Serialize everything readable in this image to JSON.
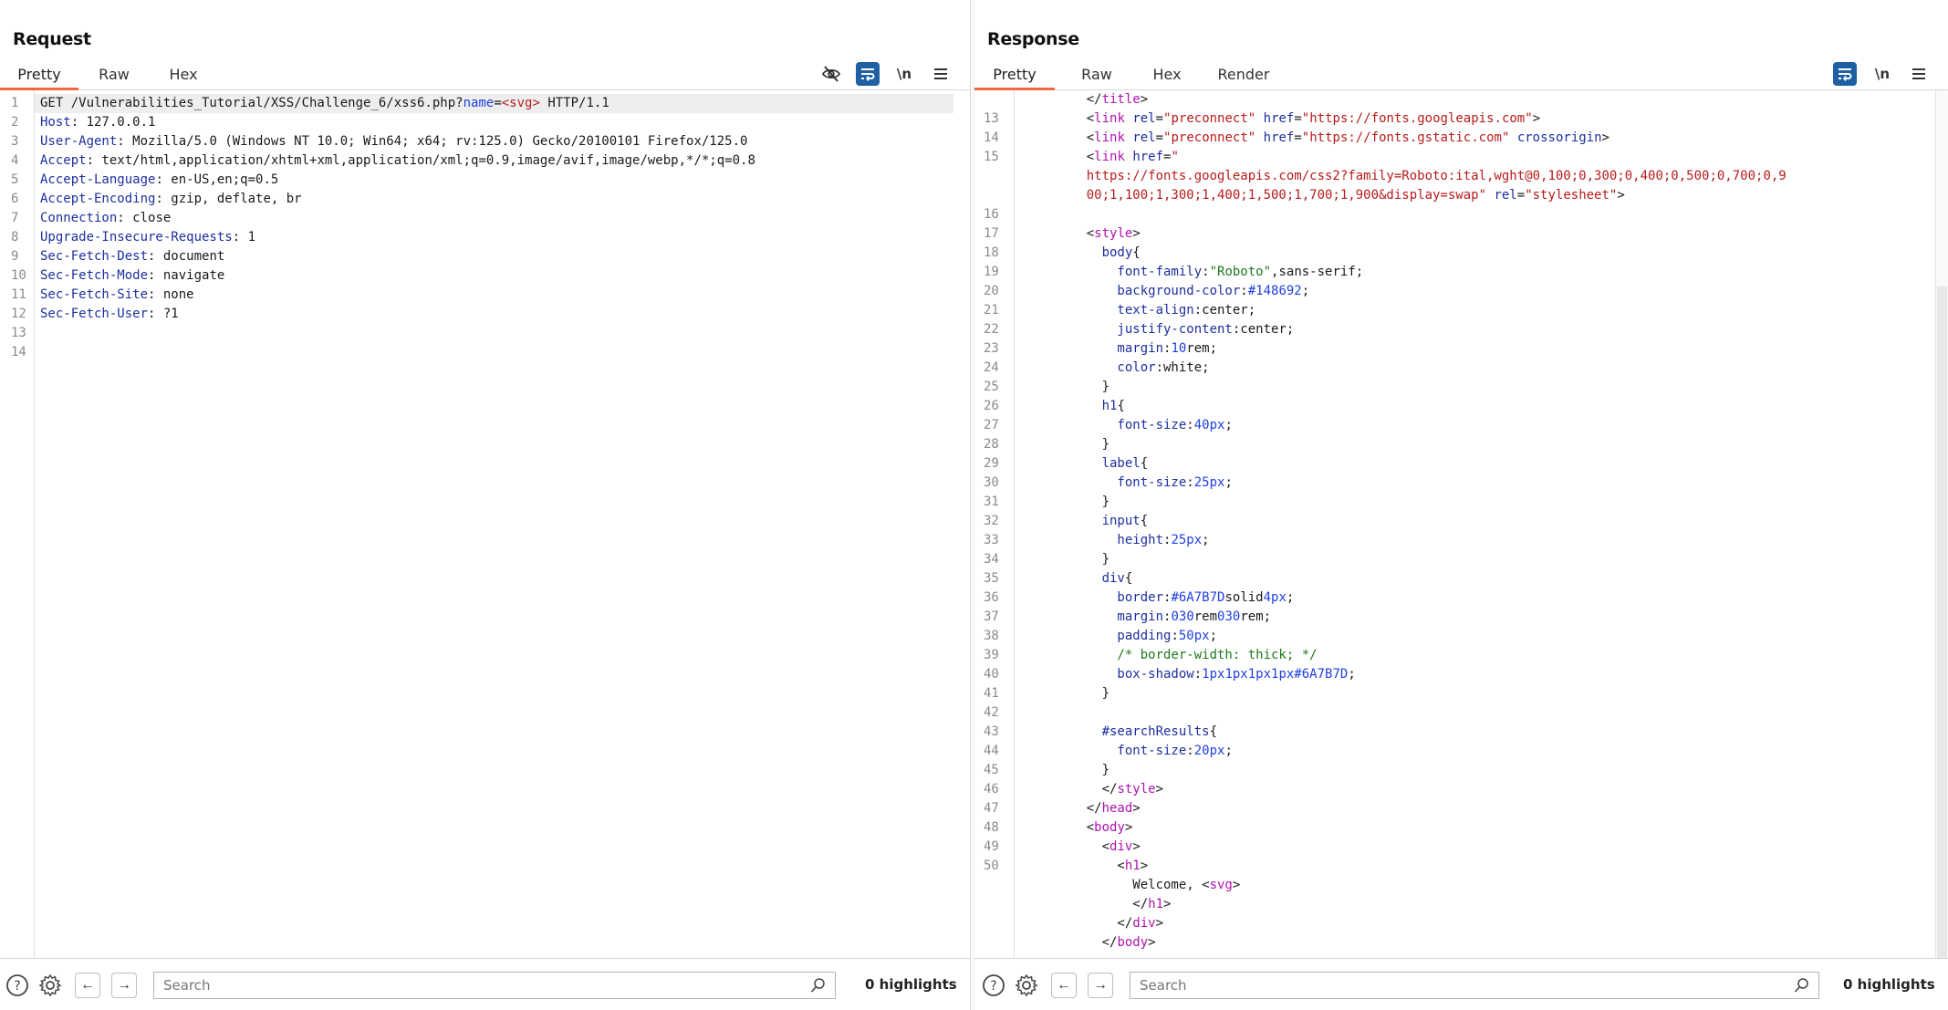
{
  "layout_toggle": {
    "options": [
      {
        "name": "side-by-side",
        "active": true
      },
      {
        "name": "top-bottom",
        "active": false
      },
      {
        "name": "single",
        "active": false
      }
    ]
  },
  "request": {
    "title": "Request",
    "tabs": [
      "Pretty",
      "Raw",
      "Hex"
    ],
    "active_tab": "Pretty",
    "toolbar": {
      "hide_icon": "eye-slash-icon",
      "wrap_icon": "word-wrap-icon",
      "newline_label": "\\n",
      "menu_icon": "hamburger-menu-icon"
    },
    "lines": [
      {
        "n": "1",
        "parts": [
          [
            "v",
            "GET /Vulnerabilities_Tutorial/XSS/Challenge_6/xss6.php?"
          ],
          [
            "blue",
            "name"
          ],
          [
            "v",
            "="
          ],
          [
            "red",
            "<svg>"
          ],
          [
            "v",
            " HTTP/1.1"
          ]
        ]
      },
      {
        "n": "2",
        "parts": [
          [
            "k",
            "Host"
          ],
          [
            "v",
            ": 127.0.0.1"
          ]
        ]
      },
      {
        "n": "3",
        "parts": [
          [
            "k",
            "User-Agent"
          ],
          [
            "v",
            ": Mozilla/5.0 (Windows NT 10.0; Win64; x64; rv:125.0) Gecko/20100101 Firefox/125.0"
          ]
        ]
      },
      {
        "n": "4",
        "parts": [
          [
            "k",
            "Accept"
          ],
          [
            "v",
            ": text/html,application/xhtml+xml,application/xml;q=0.9,image/avif,image/webp,*/*;q=0.8"
          ]
        ]
      },
      {
        "n": "5",
        "parts": [
          [
            "k",
            "Accept-Language"
          ],
          [
            "v",
            ": en-US,en;q=0.5"
          ]
        ]
      },
      {
        "n": "6",
        "parts": [
          [
            "k",
            "Accept-Encoding"
          ],
          [
            "v",
            ": gzip, deflate, br"
          ]
        ]
      },
      {
        "n": "7",
        "parts": [
          [
            "k",
            "Connection"
          ],
          [
            "v",
            ": close"
          ]
        ]
      },
      {
        "n": "8",
        "parts": [
          [
            "k",
            "Upgrade-Insecure-Requests"
          ],
          [
            "v",
            ": 1"
          ]
        ]
      },
      {
        "n": "9",
        "parts": [
          [
            "k",
            "Sec-Fetch-Dest"
          ],
          [
            "v",
            ": document"
          ]
        ]
      },
      {
        "n": "10",
        "parts": [
          [
            "k",
            "Sec-Fetch-Mode"
          ],
          [
            "v",
            ": navigate"
          ]
        ]
      },
      {
        "n": "11",
        "parts": [
          [
            "k",
            "Sec-Fetch-Site"
          ],
          [
            "v",
            ": none"
          ]
        ]
      },
      {
        "n": "12",
        "parts": [
          [
            "k",
            "Sec-Fetch-User"
          ],
          [
            "v",
            ": ?1"
          ]
        ]
      },
      {
        "n": "13",
        "parts": []
      },
      {
        "n": "14",
        "parts": []
      }
    ],
    "search": {
      "placeholder": "Search",
      "value": ""
    },
    "highlights": "0 highlights"
  },
  "response": {
    "title": "Response",
    "tabs": [
      "Pretty",
      "Raw",
      "Hex",
      "Render"
    ],
    "active_tab": "Pretty",
    "toolbar": {
      "wrap_icon": "word-wrap-icon",
      "newline_label": "\\n",
      "menu_icon": "hamburger-menu-icon"
    },
    "lines": [
      {
        "n": "",
        "parts": [
          [
            "v",
            "    </"
          ],
          [
            "mag",
            "title"
          ],
          [
            "v",
            ">"
          ]
        ]
      },
      {
        "n": "13",
        "parts": [
          [
            "v",
            "    <"
          ],
          [
            "mag",
            "link"
          ],
          [
            "v",
            " "
          ],
          [
            "k",
            "rel"
          ],
          [
            "v",
            "="
          ],
          [
            "str",
            "\"preconnect\""
          ],
          [
            "v",
            " "
          ],
          [
            "k",
            "href"
          ],
          [
            "v",
            "="
          ],
          [
            "str",
            "\"https://fonts.googleapis.com\""
          ],
          [
            "v",
            ">"
          ]
        ]
      },
      {
        "n": "14",
        "parts": [
          [
            "v",
            "    <"
          ],
          [
            "mag",
            "link"
          ],
          [
            "v",
            " "
          ],
          [
            "k",
            "rel"
          ],
          [
            "v",
            "="
          ],
          [
            "str",
            "\"preconnect\""
          ],
          [
            "v",
            " "
          ],
          [
            "k",
            "href"
          ],
          [
            "v",
            "="
          ],
          [
            "str",
            "\"https://fonts.gstatic.com\""
          ],
          [
            "v",
            " "
          ],
          [
            "k",
            "crossorigin"
          ],
          [
            "v",
            ">"
          ]
        ]
      },
      {
        "n": "15",
        "parts": [
          [
            "v",
            "    <"
          ],
          [
            "mag",
            "link"
          ],
          [
            "v",
            " "
          ],
          [
            "k",
            "href"
          ],
          [
            "v",
            "="
          ],
          [
            "str",
            "\""
          ]
        ]
      },
      {
        "n": "",
        "parts": [
          [
            "str",
            "    https://fonts.googleapis.com/css2?family=Roboto:ital,wght@0,100;0,300;0,400;0,500;0,700;0,9"
          ]
        ]
      },
      {
        "n": "",
        "parts": [
          [
            "str",
            "    00;1,100;1,300;1,400;1,500;1,700;1,900&display=swap\""
          ],
          [
            "v",
            " "
          ],
          [
            "k",
            "rel"
          ],
          [
            "v",
            "="
          ],
          [
            "str",
            "\"stylesheet\""
          ],
          [
            "v",
            ">"
          ]
        ]
      },
      {
        "n": "16",
        "parts": []
      },
      {
        "n": "17",
        "parts": [
          [
            "v",
            "    <"
          ],
          [
            "mag",
            "style"
          ],
          [
            "v",
            ">"
          ]
        ]
      },
      {
        "n": "18",
        "parts": [
          [
            "k",
            "      body"
          ],
          [
            "v",
            "{"
          ]
        ]
      },
      {
        "n": "19",
        "parts": [
          [
            "k",
            "        font-family"
          ],
          [
            "v",
            ":"
          ],
          [
            "grn",
            "\"Roboto\""
          ],
          [
            "v",
            ",sans-serif;"
          ]
        ]
      },
      {
        "n": "20",
        "parts": [
          [
            "k",
            "        background-color"
          ],
          [
            "v",
            ":"
          ],
          [
            "blue",
            "#148692"
          ],
          [
            "v",
            ";"
          ]
        ]
      },
      {
        "n": "21",
        "parts": [
          [
            "k",
            "        text-align"
          ],
          [
            "v",
            ":center;"
          ]
        ]
      },
      {
        "n": "22",
        "parts": [
          [
            "k",
            "        justify-content"
          ],
          [
            "v",
            ":center;"
          ]
        ]
      },
      {
        "n": "23",
        "parts": [
          [
            "k",
            "        margin"
          ],
          [
            "v",
            ":"
          ],
          [
            "blue",
            "10"
          ],
          [
            "v",
            "rem;"
          ]
        ]
      },
      {
        "n": "24",
        "parts": [
          [
            "k",
            "        color"
          ],
          [
            "v",
            ":white;"
          ]
        ]
      },
      {
        "n": "25",
        "parts": [
          [
            "v",
            "      }"
          ]
        ]
      },
      {
        "n": "26",
        "parts": [
          [
            "k",
            "      h1"
          ],
          [
            "v",
            "{"
          ]
        ]
      },
      {
        "n": "27",
        "parts": [
          [
            "k",
            "        font-size"
          ],
          [
            "v",
            ":"
          ],
          [
            "blue",
            "40px"
          ],
          [
            "v",
            ";"
          ]
        ]
      },
      {
        "n": "28",
        "parts": [
          [
            "v",
            "      }"
          ]
        ]
      },
      {
        "n": "29",
        "parts": [
          [
            "k",
            "      label"
          ],
          [
            "v",
            "{"
          ]
        ]
      },
      {
        "n": "30",
        "parts": [
          [
            "k",
            "        font-size"
          ],
          [
            "v",
            ":"
          ],
          [
            "blue",
            "25px"
          ],
          [
            "v",
            ";"
          ]
        ]
      },
      {
        "n": "31",
        "parts": [
          [
            "v",
            "      }"
          ]
        ]
      },
      {
        "n": "32",
        "parts": [
          [
            "k",
            "      input"
          ],
          [
            "v",
            "{"
          ]
        ]
      },
      {
        "n": "33",
        "parts": [
          [
            "k",
            "        height"
          ],
          [
            "v",
            ":"
          ],
          [
            "blue",
            "25px"
          ],
          [
            "v",
            ";"
          ]
        ]
      },
      {
        "n": "34",
        "parts": [
          [
            "v",
            "      }"
          ]
        ]
      },
      {
        "n": "35",
        "parts": [
          [
            "k",
            "      div"
          ],
          [
            "v",
            "{"
          ]
        ]
      },
      {
        "n": "36",
        "parts": [
          [
            "k",
            "        border"
          ],
          [
            "v",
            ":"
          ],
          [
            "blue",
            "#6A7B7D"
          ],
          [
            "v",
            "solid"
          ],
          [
            "blue",
            "4px"
          ],
          [
            "v",
            ";"
          ]
        ]
      },
      {
        "n": "37",
        "parts": [
          [
            "k",
            "        margin"
          ],
          [
            "v",
            ":"
          ],
          [
            "blue",
            "0"
          ],
          [
            "v",
            ""
          ],
          [
            "blue",
            "30"
          ],
          [
            "v",
            "rem"
          ],
          [
            "blue",
            "0"
          ],
          [
            "blue",
            "30"
          ],
          [
            "v",
            "rem;"
          ]
        ]
      },
      {
        "n": "38",
        "parts": [
          [
            "k",
            "        padding"
          ],
          [
            "v",
            ":"
          ],
          [
            "blue",
            "50px"
          ],
          [
            "v",
            ";"
          ]
        ]
      },
      {
        "n": "39",
        "parts": [
          [
            "grn",
            "        /* border-width: thick; */"
          ]
        ]
      },
      {
        "n": "40",
        "parts": [
          [
            "k",
            "        box-shadow"
          ],
          [
            "v",
            ":"
          ],
          [
            "blue",
            "1px1px1px1px#6A7B7D"
          ],
          [
            "v",
            ";"
          ]
        ]
      },
      {
        "n": "41",
        "parts": [
          [
            "v",
            "      }"
          ]
        ]
      },
      {
        "n": "42",
        "parts": []
      },
      {
        "n": "43",
        "parts": [
          [
            "k",
            "      #searchResults"
          ],
          [
            "v",
            "{"
          ]
        ]
      },
      {
        "n": "44",
        "parts": [
          [
            "k",
            "        font-size"
          ],
          [
            "v",
            ":"
          ],
          [
            "blue",
            "20px"
          ],
          [
            "v",
            ";"
          ]
        ]
      },
      {
        "n": "45",
        "parts": [
          [
            "v",
            "      }"
          ]
        ]
      },
      {
        "n": "46",
        "parts": [
          [
            "v",
            "      </"
          ],
          [
            "mag",
            "style"
          ],
          [
            "v",
            ">"
          ]
        ]
      },
      {
        "n": "47",
        "parts": [
          [
            "v",
            "    </"
          ],
          [
            "mag",
            "head"
          ],
          [
            "v",
            ">"
          ]
        ]
      },
      {
        "n": "48",
        "parts": [
          [
            "v",
            "    <"
          ],
          [
            "mag",
            "body"
          ],
          [
            "v",
            ">"
          ]
        ]
      },
      {
        "n": "49",
        "parts": [
          [
            "v",
            "      <"
          ],
          [
            "mag",
            "div"
          ],
          [
            "v",
            ">"
          ]
        ]
      },
      {
        "n": "50",
        "parts": [
          [
            "v",
            "        <"
          ],
          [
            "mag",
            "h1"
          ],
          [
            "v",
            ">"
          ]
        ]
      },
      {
        "n": "",
        "parts": [
          [
            "v",
            "          Welcome, <"
          ],
          [
            "mag",
            "svg"
          ],
          [
            "v",
            ">"
          ]
        ]
      },
      {
        "n": "",
        "parts": [
          [
            "v",
            "          </"
          ],
          [
            "mag",
            "h1"
          ],
          [
            "v",
            ">"
          ]
        ]
      },
      {
        "n": "",
        "parts": [
          [
            "v",
            "        </"
          ],
          [
            "mag",
            "div"
          ],
          [
            "v",
            ">"
          ]
        ]
      },
      {
        "n": "",
        "parts": [
          [
            "v",
            "      </"
          ],
          [
            "mag",
            "body"
          ],
          [
            "v",
            ">"
          ]
        ]
      }
    ],
    "search": {
      "placeholder": "Search",
      "value": ""
    },
    "highlights": "0 highlights"
  },
  "colors": {
    "accent_blue": "#1f5fa3",
    "tab_underline": "#ee6a3d",
    "header_key": "#1d2f9e",
    "tag_name": "#b012b0",
    "string_value": "#b81b1b",
    "number_value": "#1f3fe0",
    "comment": "#1d7a1d"
  }
}
